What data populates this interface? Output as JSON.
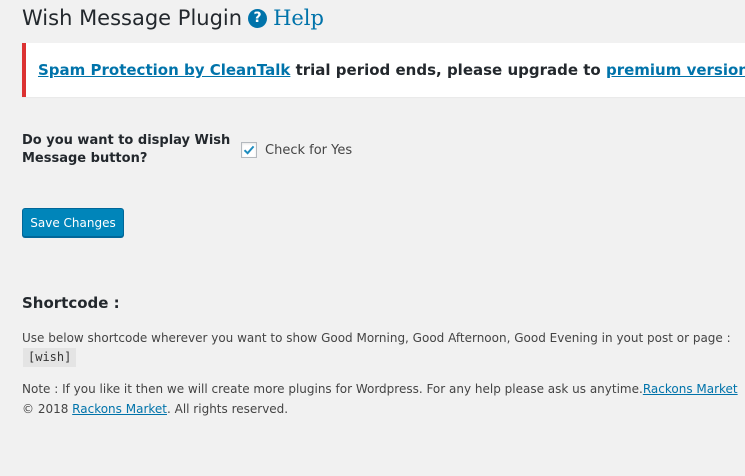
{
  "header": {
    "title": "Wish Message Plugin",
    "help_icon_glyph": "?",
    "help_label": "Help",
    "help_icon": "question-circle-icon"
  },
  "notice": {
    "link1": "Spam Protection by CleanTalk",
    "middle": " trial period ends, please upgrade to ",
    "link2": "premium version",
    "end": "!",
    "border_color": "#dc3232"
  },
  "settings": {
    "question": "Do you want to display Wish Message button?",
    "checkbox_label": "Check for Yes",
    "checkbox_checked": true,
    "save_label": "Save Changes"
  },
  "shortcode": {
    "heading": "Shortcode :",
    "description": "Use below shortcode wherever you want to show Good Morning, Good Afternoon, Good Evening in yout post or page :",
    "code": "[wish]"
  },
  "footer": {
    "note": "Note : If you like it then we will create more plugins for Wordpress. For any help please ask us anytime.",
    "note_link": "Rackons Market",
    "copyright": "© 2018 ",
    "copyright_link": "Rackons Market",
    "rights": ". All rights reserved."
  },
  "colors": {
    "accent": "#0073aa",
    "button": "#0085ba",
    "background": "#f1f1f1"
  }
}
